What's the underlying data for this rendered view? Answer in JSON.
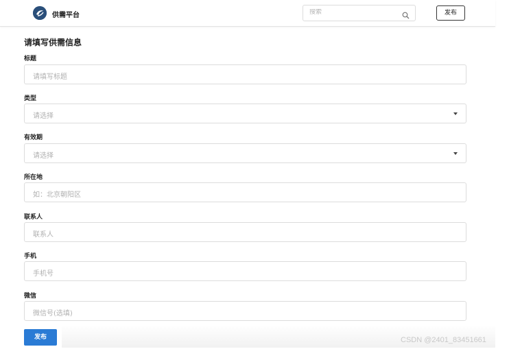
{
  "header": {
    "brand": "供需平台",
    "search_placeholder": "搜索",
    "publish_label": "发布"
  },
  "form": {
    "title": "请填写供需信息",
    "fields": [
      {
        "label": "标题",
        "placeholder": "请填写标题"
      },
      {
        "label": "类型",
        "placeholder": "请选择"
      },
      {
        "label": "有效期",
        "placeholder": "请选择"
      },
      {
        "label": "所在地",
        "placeholder": "如：北京朝阳区"
      },
      {
        "label": "联系人",
        "placeholder": "联系人"
      },
      {
        "label": "手机",
        "placeholder": "手机号"
      },
      {
        "label": "微信",
        "placeholder": "微信号(选填)"
      }
    ],
    "submit_label": "发布"
  },
  "watermark": "CSDN @2401_83451661",
  "colors": {
    "accent": "#2a7bd5",
    "logo": "#2a4f7a"
  }
}
